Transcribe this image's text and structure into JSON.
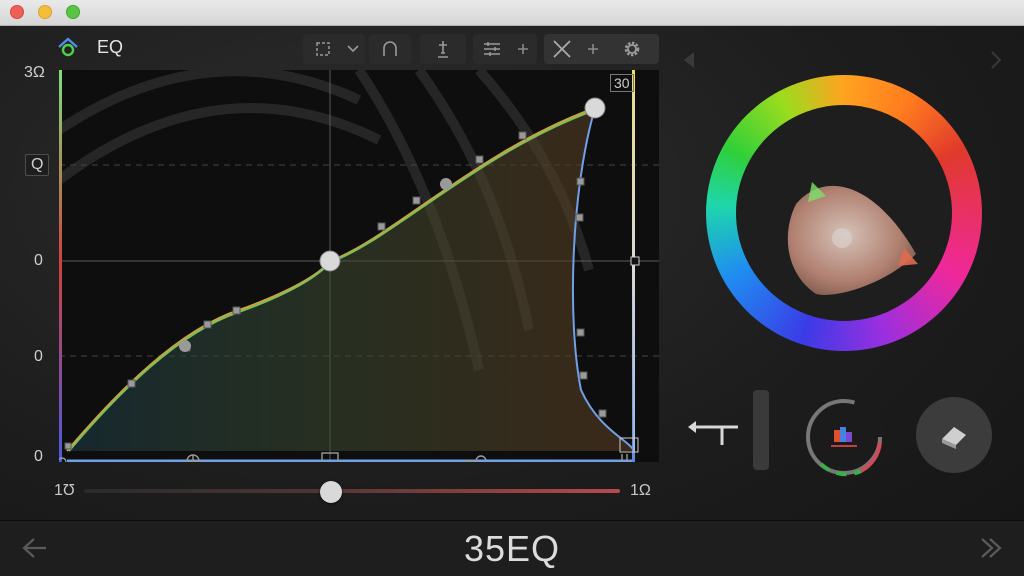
{
  "window": {
    "title": "EQ",
    "status_title": "35EQ"
  },
  "toolbar": {
    "groups": [
      {
        "items": [
          "crop-icon",
          "chevron-down-icon"
        ]
      },
      {
        "items": [
          "arch-icon"
        ]
      },
      {
        "items": [
          "pin-icon"
        ]
      },
      {
        "items": [
          "sliders-icon",
          "plus-icon"
        ]
      },
      {
        "items": [
          "cross-icon",
          "plus-icon",
          "gear-icon"
        ]
      }
    ]
  },
  "graph": {
    "y_labels": [
      "3Ω",
      "Q",
      "0",
      "0",
      "0"
    ],
    "right_top_label": "30",
    "x_left_label": "1Ʊ",
    "x_right_label": "1Ω"
  },
  "colors": {
    "accent_blue": "#6fa0e8",
    "curve_green": "#7bbf5a",
    "slider_red": "#b84a4a"
  },
  "icons": {
    "left_nav": "arrow-left-icon",
    "right_nav": "arrow-right-icon",
    "erase": "eraser-icon",
    "hue_wheel": "color-wheel-icon"
  }
}
